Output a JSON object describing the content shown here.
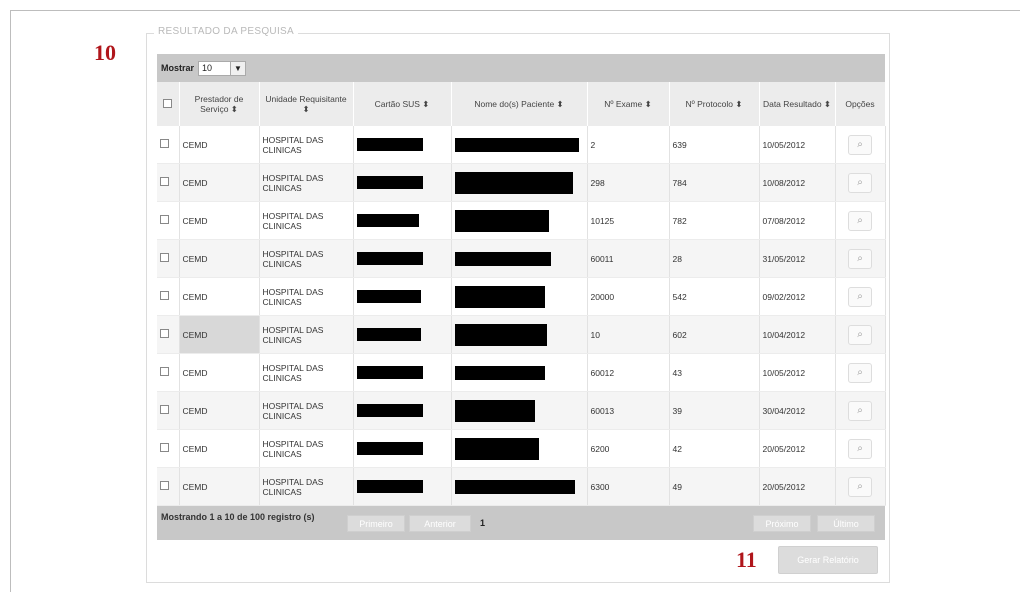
{
  "markers": {
    "a": "10",
    "b": "11"
  },
  "section_title": "RESULTADO DA PESQUISA",
  "show": {
    "label": "Mostrar",
    "value": "10",
    "arrow": "▼"
  },
  "columns": [
    "",
    "Prestador de Serviço ⬍",
    "Unidade Requisitante ⬍",
    "Cartão SUS ⬍",
    "Nome do(s) Paciente ⬍",
    "Nº Exame ⬍",
    "Nº Protocolo ⬍",
    "Data Resultado ⬍",
    "Opções"
  ],
  "rows": [
    {
      "prestador": "CEMD",
      "unidade": "HOSPITAL DAS CLINICAS",
      "exame": "2",
      "protocolo": "639",
      "data": "10/05/2012"
    },
    {
      "prestador": "CEMD",
      "unidade": "HOSPITAL DAS CLINICAS",
      "exame": "298",
      "protocolo": "784",
      "data": "10/08/2012"
    },
    {
      "prestador": "CEMD",
      "unidade": "HOSPITAL DAS CLINICAS",
      "exame": "10125",
      "protocolo": "782",
      "data": "07/08/2012"
    },
    {
      "prestador": "CEMD",
      "unidade": "HOSPITAL DAS CLINICAS",
      "exame": "60011",
      "protocolo": "28",
      "data": "31/05/2012"
    },
    {
      "prestador": "CEMD",
      "unidade": "HOSPITAL DAS CLINICAS",
      "exame": "20000",
      "protocolo": "542",
      "data": "09/02/2012"
    },
    {
      "prestador": "CEMD",
      "unidade": "HOSPITAL DAS CLINICAS",
      "exame": "10",
      "protocolo": "602",
      "data": "10/04/2012"
    },
    {
      "prestador": "CEMD",
      "unidade": "HOSPITAL DAS CLINICAS",
      "exame": "60012",
      "protocolo": "43",
      "data": "10/05/2012"
    },
    {
      "prestador": "CEMD",
      "unidade": "HOSPITAL DAS CLINICAS",
      "exame": "60013",
      "protocolo": "39",
      "data": "30/04/2012"
    },
    {
      "prestador": "CEMD",
      "unidade": "HOSPITAL DAS CLINICAS",
      "exame": "6200",
      "protocolo": "42",
      "data": "20/05/2012"
    },
    {
      "prestador": "CEMD",
      "unidade": "HOSPITAL DAS CLINICAS",
      "exame": "6300",
      "protocolo": "49",
      "data": "20/05/2012"
    }
  ],
  "footer": {
    "info": "Mostrando 1 a 10 de 100 registro (s)",
    "first": "Primeiro",
    "prev": "Anterior",
    "current_page": "1",
    "next": "Próximo",
    "last": "Último"
  },
  "generate_button": "Gerar Relatório"
}
